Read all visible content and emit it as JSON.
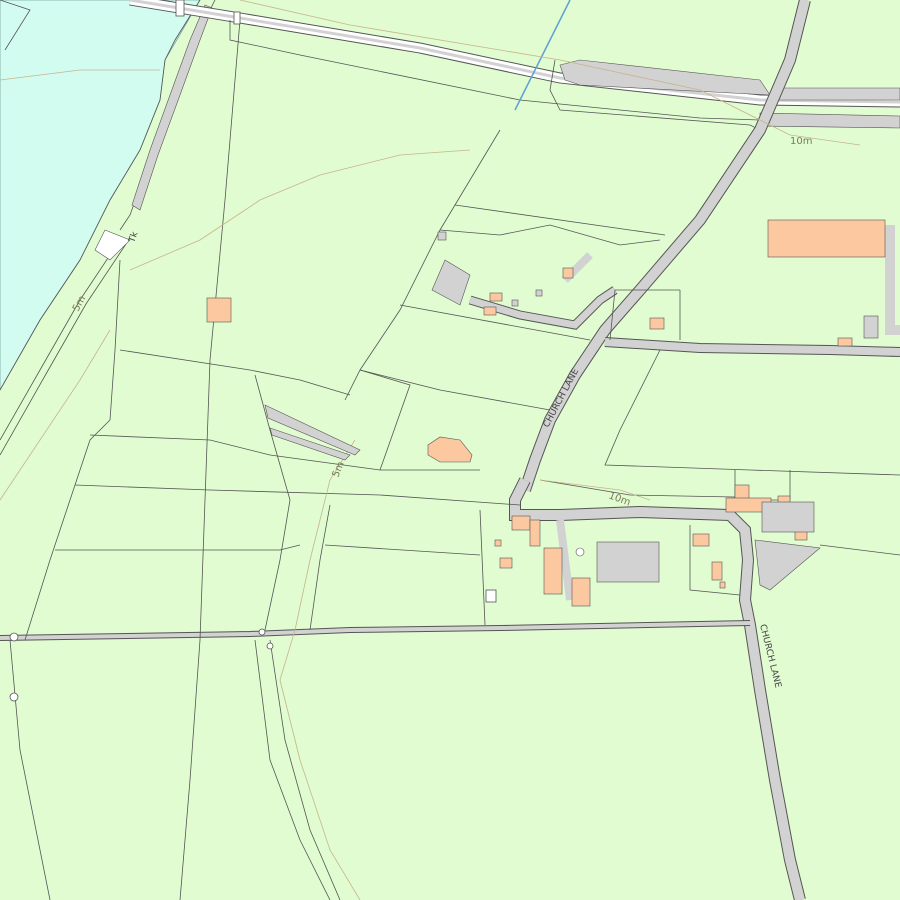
{
  "map": {
    "colors": {
      "land": "#e0fcd0",
      "water": "#d2fcf0",
      "road": "#d2d2d2",
      "building": "#fcc8a0",
      "line": "#555555",
      "contour": "#c8b48c"
    },
    "road_labels": {
      "church_lane_north": "CHURCH LANE",
      "church_lane_south": "CHURCH LANE"
    },
    "contour_labels": {
      "c10_east": "10m",
      "c10_mid": "10m",
      "c5_centre": "5m",
      "c5_west": "5m"
    },
    "small_labels": {
      "track": "Tk"
    }
  }
}
